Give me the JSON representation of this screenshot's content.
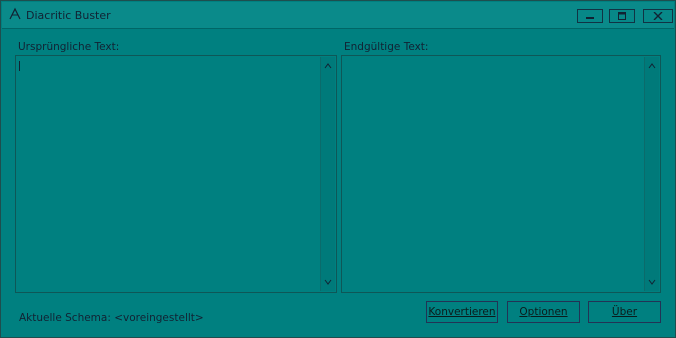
{
  "window": {
    "title": "Diacritic Buster",
    "controls": {
      "minimize": "minimize",
      "maximize": "maximize",
      "close": "close"
    }
  },
  "panes": {
    "source": {
      "label": "Ursprüngliche Text:",
      "value": ""
    },
    "result": {
      "label": "Endgültige Text:",
      "value": ""
    }
  },
  "status": {
    "schema": "Aktuelle Schema: <voreingestellt>"
  },
  "buttons": {
    "convert": "Konvertieren",
    "options": "Optionen",
    "about": "Über"
  },
  "colors": {
    "background": "#008080",
    "border": "#0e5757",
    "text": "#123333"
  },
  "icons": {
    "app": "diacritic-app-icon",
    "scroll_up": "chevron-up-icon",
    "scroll_down": "chevron-down-icon"
  }
}
